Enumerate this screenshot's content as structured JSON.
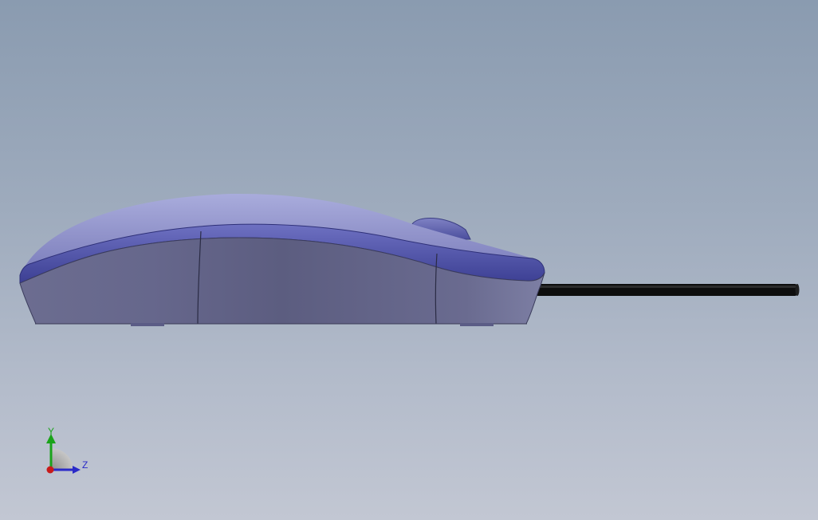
{
  "view": {
    "model": "computer-mouse",
    "orientation": "side-right",
    "colors": {
      "background_top": "#8a9bb0",
      "background_bottom": "#c2c7d3",
      "body_face": "#5f5f84",
      "top_shell": "#8d8fc6",
      "trim_band": "#5558a8",
      "cable": "#111111"
    }
  },
  "triad": {
    "y_label": "Y",
    "z_label": "Z",
    "colors": {
      "y": "#1aa31a",
      "z": "#2a2ac8",
      "x": "#c81a1a"
    }
  }
}
